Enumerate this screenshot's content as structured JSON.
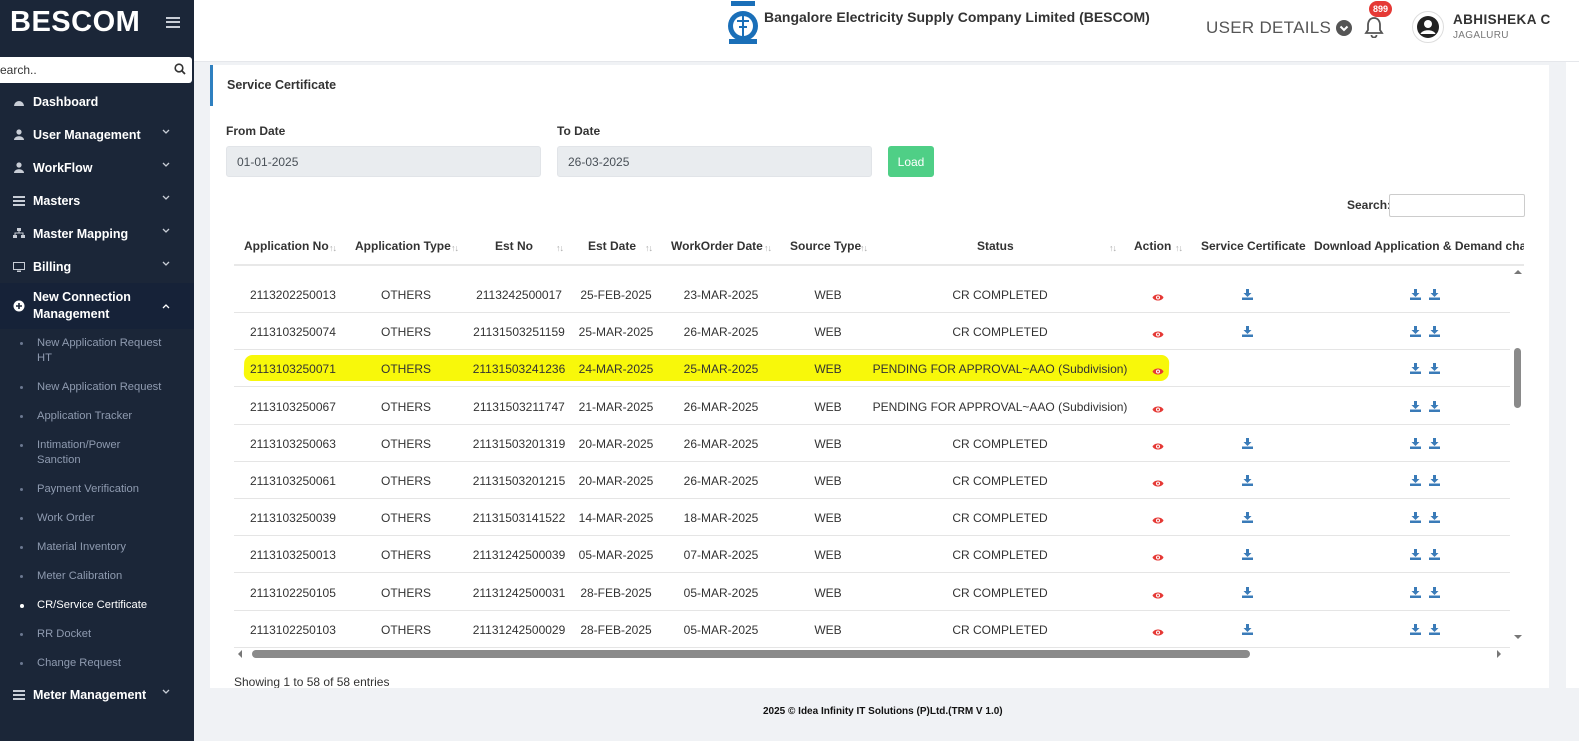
{
  "sidebar": {
    "brand": "BESCOM",
    "search_placeholder": "Search..",
    "menu": [
      {
        "label": "Dashboard"
      },
      {
        "label": "User Management"
      },
      {
        "label": "WorkFlow"
      },
      {
        "label": "Masters"
      },
      {
        "label": "Master Mapping"
      },
      {
        "label": "Billing"
      },
      {
        "label": "New Connection Management"
      }
    ],
    "submenu": [
      "New Application Request HT",
      "New Application Request",
      "Application Tracker",
      "Intimation/Power Sanction",
      "Payment Verification",
      "Work Order",
      "Material Inventory",
      "Meter Calibration",
      "CR/Service Certificate",
      "RR Docket",
      "Change Request"
    ],
    "bottom_item": "Meter Management"
  },
  "header": {
    "company": "Bangalore Electricity Supply Company Limited (BESCOM)",
    "user_details": "USER DETAILS",
    "notification_count": "899",
    "user_name": "ABHISHEKA C",
    "user_location": "JAGALURU"
  },
  "page": {
    "title": "Service Certificate",
    "from_label": "From Date",
    "from_value": "01-01-2025",
    "to_label": "To Date",
    "to_value": "26-03-2025",
    "load_label": "Load",
    "search_label": "Search:",
    "showing": "Showing 1 to 58 of 58 entries"
  },
  "table": {
    "headers": [
      "Application No",
      "Application Type",
      "Est No",
      "Est Date",
      "WorkOrder Date",
      "Source Type",
      "Status",
      "Action",
      "Service Certificate",
      "Download Application & Demand charge"
    ],
    "rows": [
      {
        "app_no": "2113202250013",
        "type": "OTHERS",
        "est_no": "2113242500017",
        "est_date": "25-FEB-2025",
        "wo_date": "23-MAR-2025",
        "source": "WEB",
        "status": "CR COMPLETED",
        "cert": true
      },
      {
        "app_no": "2113103250074",
        "type": "OTHERS",
        "est_no": "21131503251159",
        "est_date": "25-MAR-2025",
        "wo_date": "26-MAR-2025",
        "source": "WEB",
        "status": "CR COMPLETED",
        "cert": true
      },
      {
        "app_no": "2113103250071",
        "type": "OTHERS",
        "est_no": "21131503241236",
        "est_date": "24-MAR-2025",
        "wo_date": "25-MAR-2025",
        "source": "WEB",
        "status": "PENDING FOR APPROVAL~AAO (Subdivision)",
        "cert": false,
        "highlight": true
      },
      {
        "app_no": "2113103250067",
        "type": "OTHERS",
        "est_no": "21131503211747",
        "est_date": "21-MAR-2025",
        "wo_date": "26-MAR-2025",
        "source": "WEB",
        "status": "PENDING FOR APPROVAL~AAO (Subdivision)",
        "cert": false
      },
      {
        "app_no": "2113103250063",
        "type": "OTHERS",
        "est_no": "21131503201319",
        "est_date": "20-MAR-2025",
        "wo_date": "26-MAR-2025",
        "source": "WEB",
        "status": "CR COMPLETED",
        "cert": true
      },
      {
        "app_no": "2113103250061",
        "type": "OTHERS",
        "est_no": "21131503201215",
        "est_date": "20-MAR-2025",
        "wo_date": "26-MAR-2025",
        "source": "WEB",
        "status": "CR COMPLETED",
        "cert": true
      },
      {
        "app_no": "2113103250039",
        "type": "OTHERS",
        "est_no": "21131503141522",
        "est_date": "14-MAR-2025",
        "wo_date": "18-MAR-2025",
        "source": "WEB",
        "status": "CR COMPLETED",
        "cert": true
      },
      {
        "app_no": "2113103250013",
        "type": "OTHERS",
        "est_no": "21131242500039",
        "est_date": "05-MAR-2025",
        "wo_date": "07-MAR-2025",
        "source": "WEB",
        "status": "CR COMPLETED",
        "cert": true
      },
      {
        "app_no": "2113102250105",
        "type": "OTHERS",
        "est_no": "21131242500031",
        "est_date": "28-FEB-2025",
        "wo_date": "05-MAR-2025",
        "source": "WEB",
        "status": "CR COMPLETED",
        "cert": true
      },
      {
        "app_no": "2113102250103",
        "type": "OTHERS",
        "est_no": "21131242500029",
        "est_date": "28-FEB-2025",
        "wo_date": "05-MAR-2025",
        "source": "WEB",
        "status": "CR COMPLETED",
        "cert": true
      }
    ]
  },
  "footer": "2025 © Idea Infinity IT Solutions (P)Ltd.(TRM V 1.0)",
  "colors": {
    "sidebar": "#1b2638",
    "accent": "#2f80c0",
    "load": "#4fcf86",
    "highlight": "#f8f80a",
    "eye": "#e53935",
    "download": "#3a7bb8"
  },
  "icons": [
    "search-icon",
    "dashboard-icon",
    "user-icon",
    "workflow-icon",
    "masters-icon",
    "mapping-icon",
    "billing-icon",
    "plus-circle-icon",
    "chevron-down-icon",
    "bell-icon",
    "eye-icon",
    "download-icon"
  ]
}
